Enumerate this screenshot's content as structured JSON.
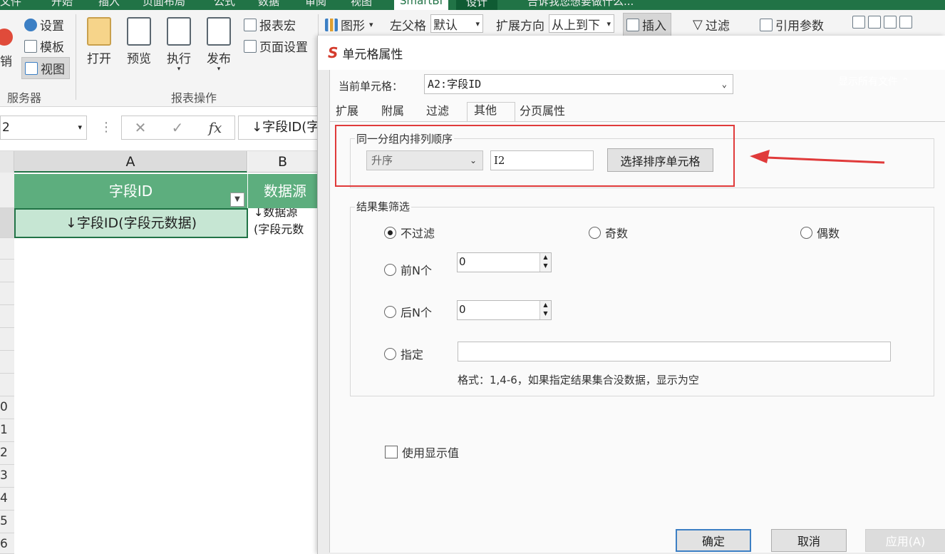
{
  "ribbon": {
    "tabs": [
      "文件",
      "开始",
      "插入",
      "页面布局",
      "公式",
      "数据",
      "审阅",
      "视图",
      "SmartBI",
      "设计",
      "告诉我您想要做什么..."
    ],
    "cancel_label": "销",
    "settings_label": "设置",
    "template_label": "模板",
    "view_label": "视图",
    "open_label": "打开",
    "preview_label": "预览",
    "execute_label": "执行",
    "publish_label": "发布",
    "report_macro_label": "报表宏",
    "page_setup_label": "页面设置",
    "chart_label": "图形",
    "left_parent_label": "左父格",
    "left_parent_value": "默认",
    "expand_dir_label": "扩展方向",
    "expand_dir_value": "从上到下",
    "insert_label": "插入",
    "filter_label": "过滤",
    "ref_param_label": "引用参数",
    "group_server": "服务器",
    "group_report_ops": "报表操作"
  },
  "formula_bar": {
    "name_box": "2",
    "formula": "↓字段ID(字"
  },
  "sheet": {
    "col_a": "A",
    "col_b": "B",
    "header_a": "字段ID",
    "header_b": "数据源",
    "cell_a2": "↓字段ID(字段元数据)",
    "cell_b2_line1": "↓数据源",
    "cell_b2_line2": "(字段元数",
    "row_numbers": [
      "",
      "",
      "",
      "",
      "",
      "",
      "",
      "",
      "",
      "0",
      "1",
      "2",
      "3",
      "4",
      "5",
      "6"
    ]
  },
  "dialog": {
    "title": "单元格属性",
    "show_all_files": "显示所有文件 ⌃",
    "current_cell_label": "当前单元格：",
    "current_cell_value": "A2:字段ID",
    "tabs": [
      "扩展",
      "附属",
      "过滤",
      "其他",
      "分页属性"
    ],
    "active_tab": "其他",
    "sort_group": {
      "legend": "同一分组内排列顺序",
      "order_value": "升序",
      "cell_value": "I2",
      "choose_button": "选择排序单元格"
    },
    "filter_group": {
      "legend": "结果集筛选",
      "no_filter": "不过滤",
      "odd": "奇数",
      "even": "偶数",
      "first_n": "前N个",
      "first_n_value": "0",
      "last_n": "后N个",
      "last_n_value": "0",
      "specify": "指定",
      "specify_value": "",
      "format_hint": "格式：1,4-6，如果指定结果集合没数据，显示为空"
    },
    "use_display_value": "使用显示值",
    "ok": "确定",
    "cancel": "取消",
    "apply": "应用(A)"
  },
  "colors": {
    "excel_green": "#217346",
    "header_green": "#5dae7e",
    "selected_cell": "#c6e6d3",
    "highlight_red": "#e03a3a"
  }
}
